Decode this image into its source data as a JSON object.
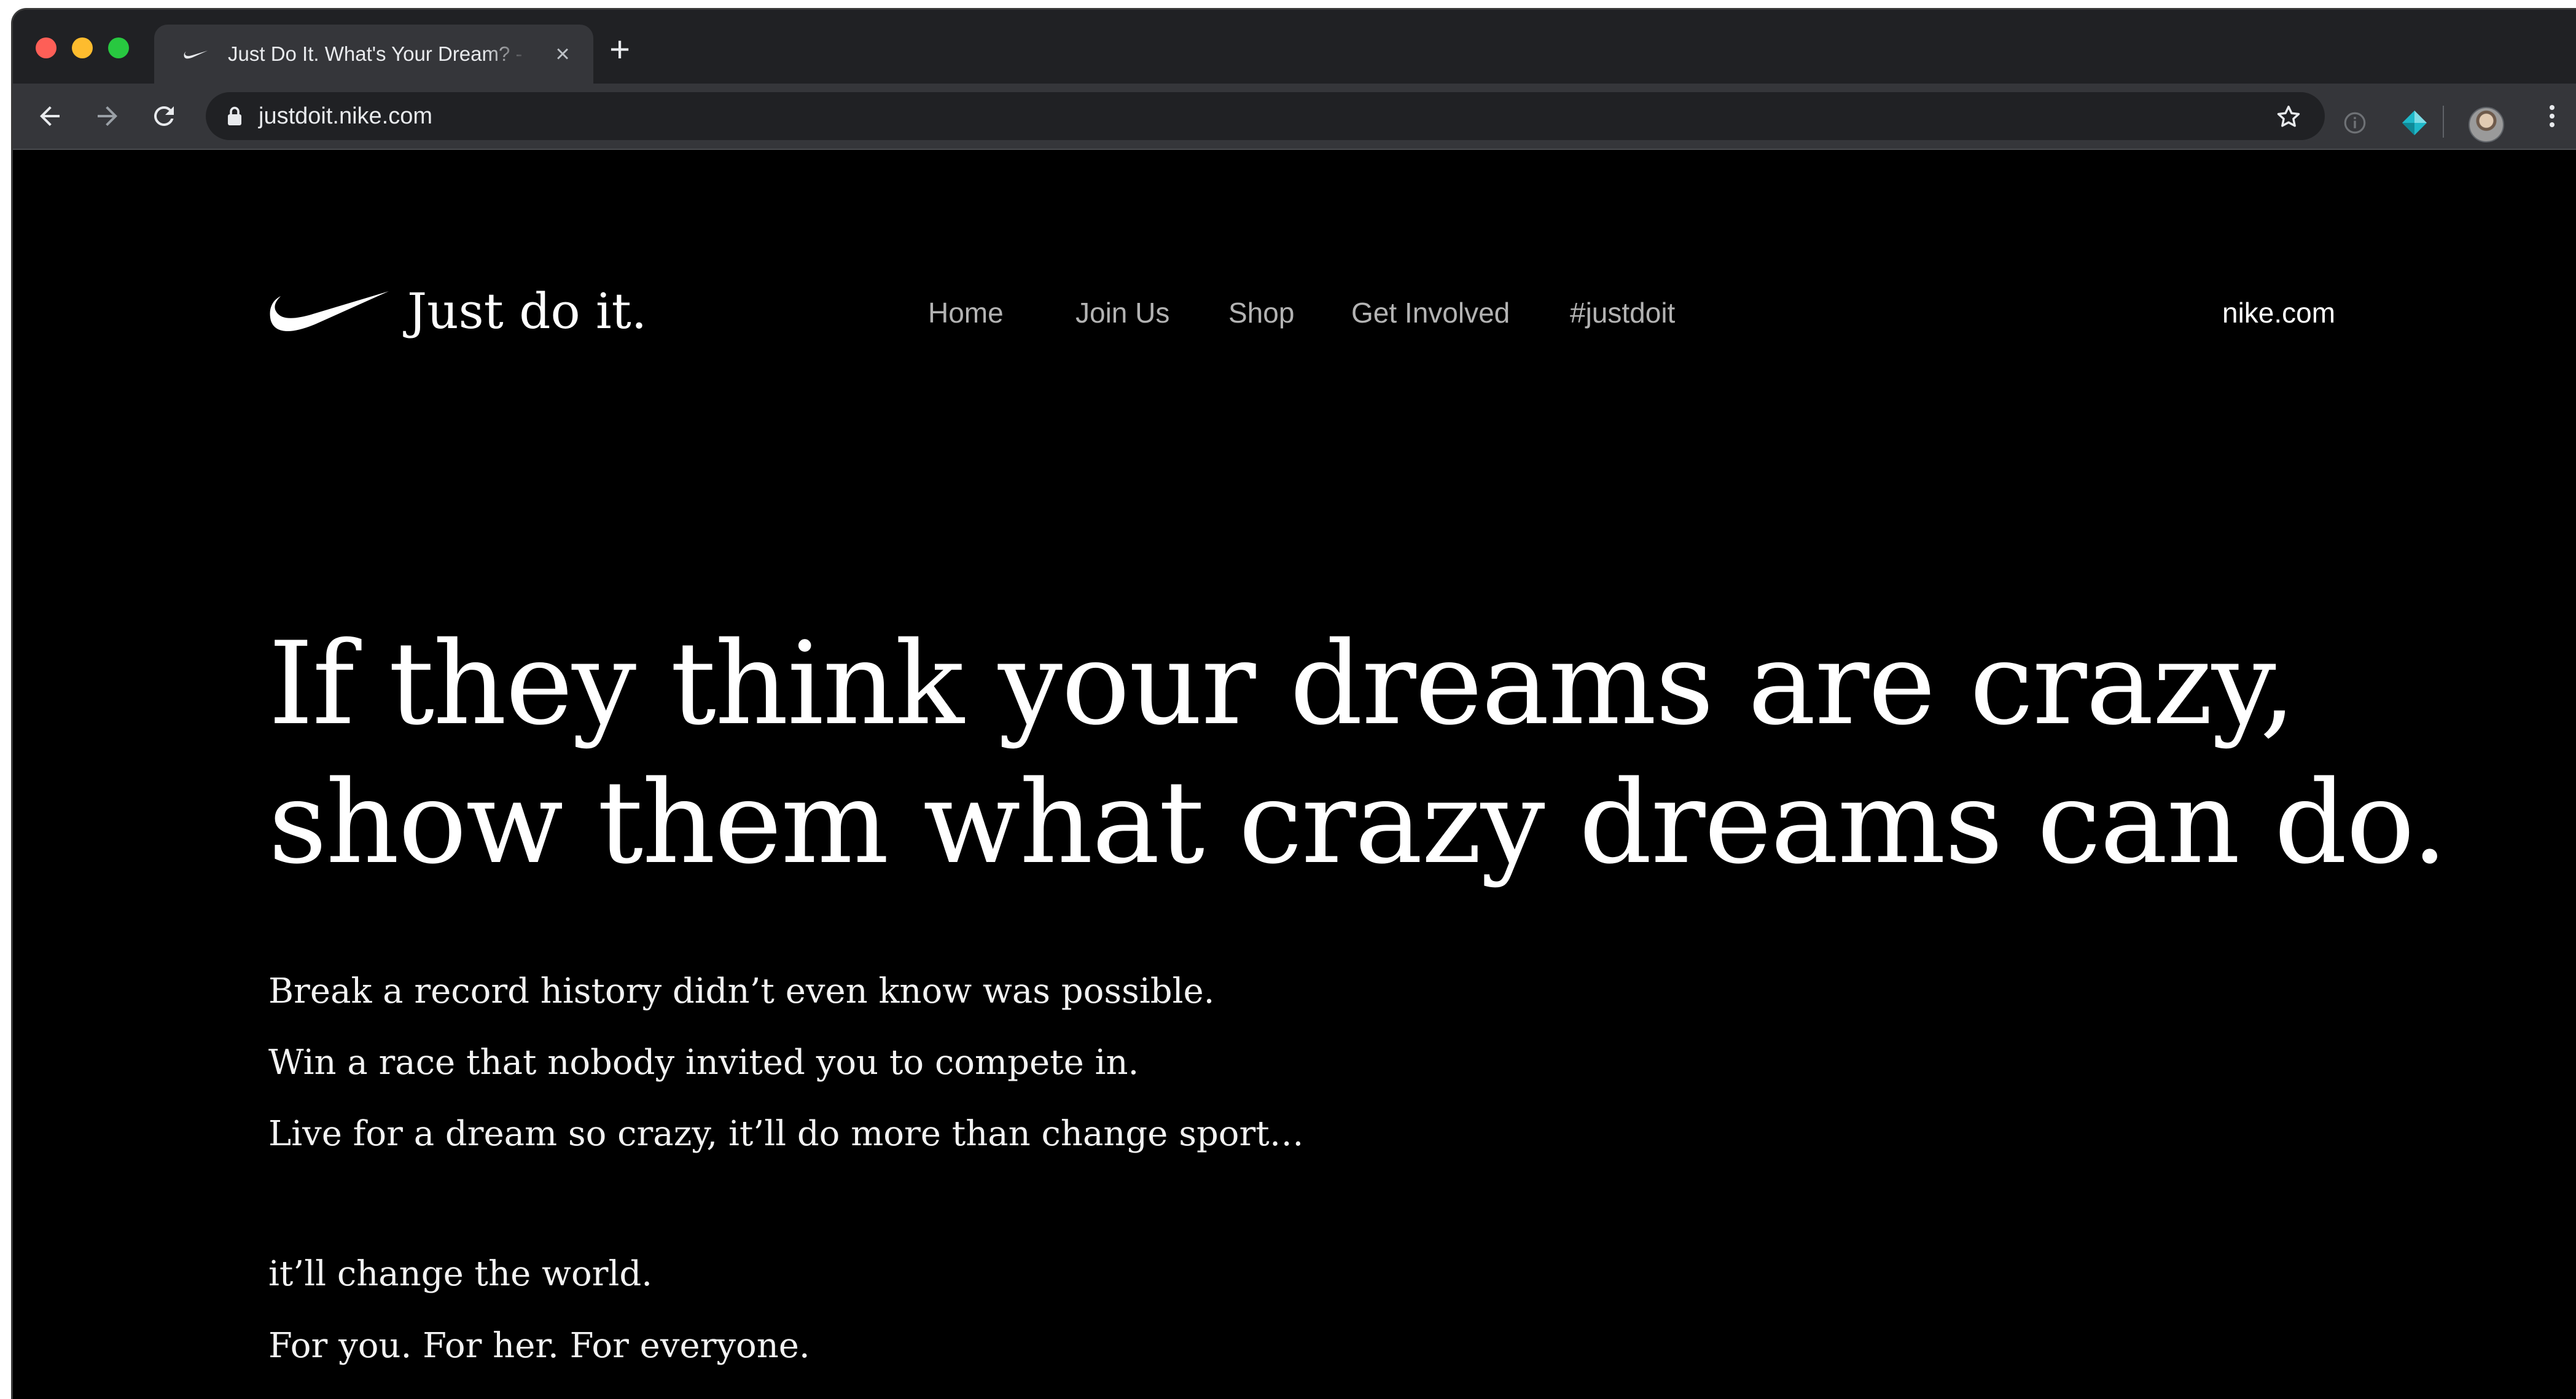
{
  "browser": {
    "tab": {
      "title": "Just Do It. What's Your Dream? - Nike",
      "close_icon": "close-icon"
    },
    "new_tab_icon": "plus-icon",
    "toolbar": {
      "back_icon": "arrow-left-icon",
      "forward_icon": "arrow-right-icon",
      "reload_icon": "reload-icon",
      "lock_icon": "lock-icon",
      "url": "justdoit.nike.com",
      "bookmark_icon": "star-icon",
      "menu_icon": "kebab-menu-icon"
    }
  },
  "site": {
    "logo_text": "Just do it.",
    "nav": [
      {
        "label": "Home"
      },
      {
        "label": "Join Us"
      },
      {
        "label": "Shop"
      },
      {
        "label": "Get Involved"
      },
      {
        "label": "#justdoit"
      }
    ],
    "external_link": "nike.com",
    "headline": [
      "If they think your dreams are crazy,",
      "show them what crazy dreams can do."
    ],
    "body": [
      "Break a record history didn’t even know was possible.",
      "Win a race that nobody invited you to compete in.",
      "Live for a dream so crazy, it’ll do more than change sport…",
      "it’ll change the world.",
      "For you. For her. For everyone."
    ]
  },
  "colors": {
    "page_background": "#000000",
    "text_primary": "#ffffff",
    "nav_text": "#b3b3b3",
    "chrome_dark": "#202124",
    "chrome_toolbar": "#35363a"
  }
}
